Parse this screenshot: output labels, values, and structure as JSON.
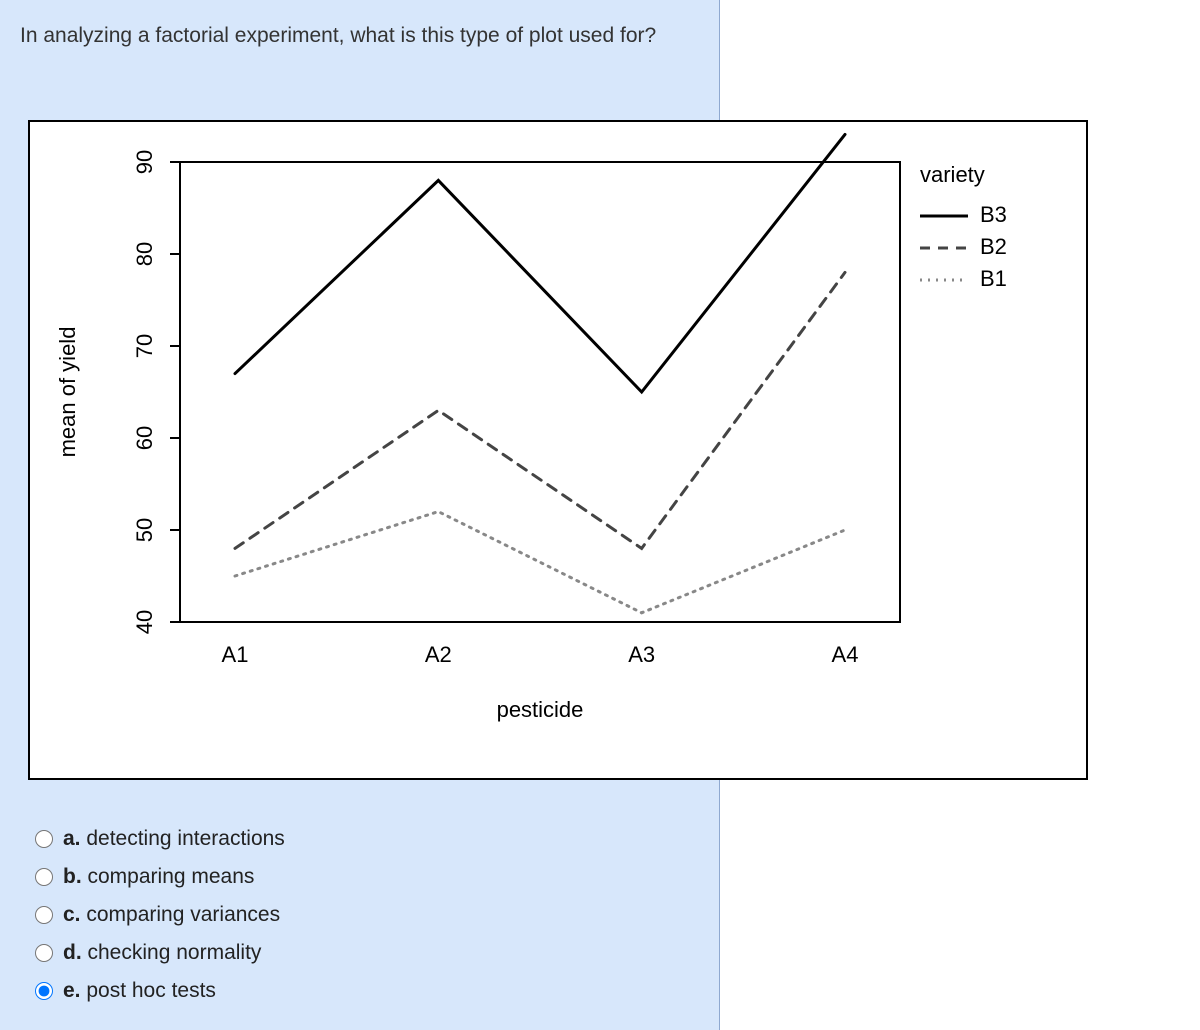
{
  "question": "In analyzing a factorial experiment, what is this type of plot used for?",
  "answers": [
    {
      "key": "a",
      "label": "detecting interactions",
      "selected": false
    },
    {
      "key": "b",
      "label": "comparing means",
      "selected": false
    },
    {
      "key": "c",
      "label": "comparing variances",
      "selected": false
    },
    {
      "key": "d",
      "label": "checking normality",
      "selected": false
    },
    {
      "key": "e",
      "label": "post hoc tests",
      "selected": true
    }
  ],
  "chart_data": {
    "type": "line",
    "xlabel": "pesticide",
    "ylabel": "mean of yield",
    "categories": [
      "A1",
      "A2",
      "A3",
      "A4"
    ],
    "ylim": [
      40,
      90
    ],
    "yticks": [
      40,
      50,
      60,
      70,
      80,
      90
    ],
    "legend_title": "variety",
    "series": [
      {
        "name": "B3",
        "style": "solid",
        "values": [
          67,
          88,
          65,
          93
        ]
      },
      {
        "name": "B2",
        "style": "dashed",
        "values": [
          48,
          63,
          48,
          78
        ]
      },
      {
        "name": "B1",
        "style": "dotted",
        "values": [
          45,
          52,
          41,
          50
        ]
      }
    ]
  }
}
